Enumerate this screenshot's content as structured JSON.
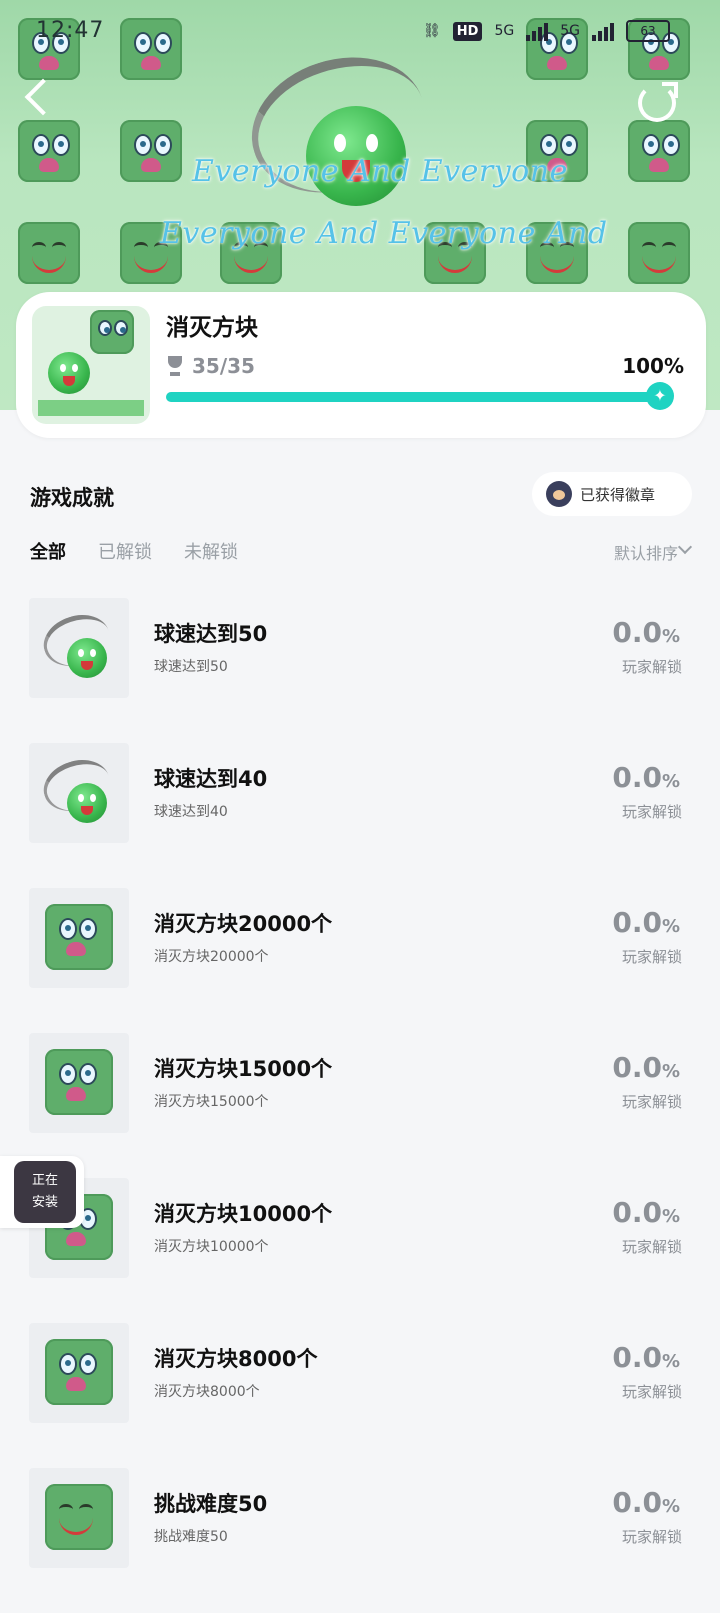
{
  "status_bar": {
    "time": "12:47",
    "hd": "HD",
    "network_left": "5G",
    "network_right": "5G",
    "battery": "63"
  },
  "hero": {
    "text_line1": "Everyone And Everyone",
    "text_line2": "Everyone And Everyone And"
  },
  "game": {
    "title": "消灭方块",
    "progress_text": "35/35",
    "progress_percent_label": "100%",
    "progress_value": 1.0
  },
  "section": {
    "title": "游戏成就",
    "badges_button": "已获得徽章",
    "tabs": [
      "全部",
      "已解锁",
      "未解锁"
    ],
    "sort_label": "默认排序"
  },
  "achievements": [
    {
      "title": "球速达到50",
      "desc": "球速达到50",
      "value": "0.0",
      "unit": "%",
      "label": "玩家解锁",
      "icon": "green-ball-icon"
    },
    {
      "title": "球速达到40",
      "desc": "球速达到40",
      "value": "0.0",
      "unit": "%",
      "label": "玩家解锁",
      "icon": "green-ball-icon"
    },
    {
      "title": "消灭方块20000个",
      "desc": "消灭方块20000个",
      "value": "0.0",
      "unit": "%",
      "label": "玩家解锁",
      "icon": "green-block-icon"
    },
    {
      "title": "消灭方块15000个",
      "desc": "消灭方块15000个",
      "value": "0.0",
      "unit": "%",
      "label": "玩家解锁",
      "icon": "green-block-icon"
    },
    {
      "title": "消灭方块10000个",
      "desc": "消灭方块10000个",
      "value": "0.0",
      "unit": "%",
      "label": "玩家解锁",
      "icon": "green-block-icon"
    },
    {
      "title": "消灭方块8000个",
      "desc": "消灭方块8000个",
      "value": "0.0",
      "unit": "%",
      "label": "玩家解锁",
      "icon": "green-block-icon"
    },
    {
      "title": "挑战难度50",
      "desc": "挑战难度50",
      "value": "0.0",
      "unit": "%",
      "label": "玩家解锁",
      "icon": "happy-block-icon"
    }
  ],
  "installing": {
    "line1": "正在",
    "line2": "安装"
  }
}
